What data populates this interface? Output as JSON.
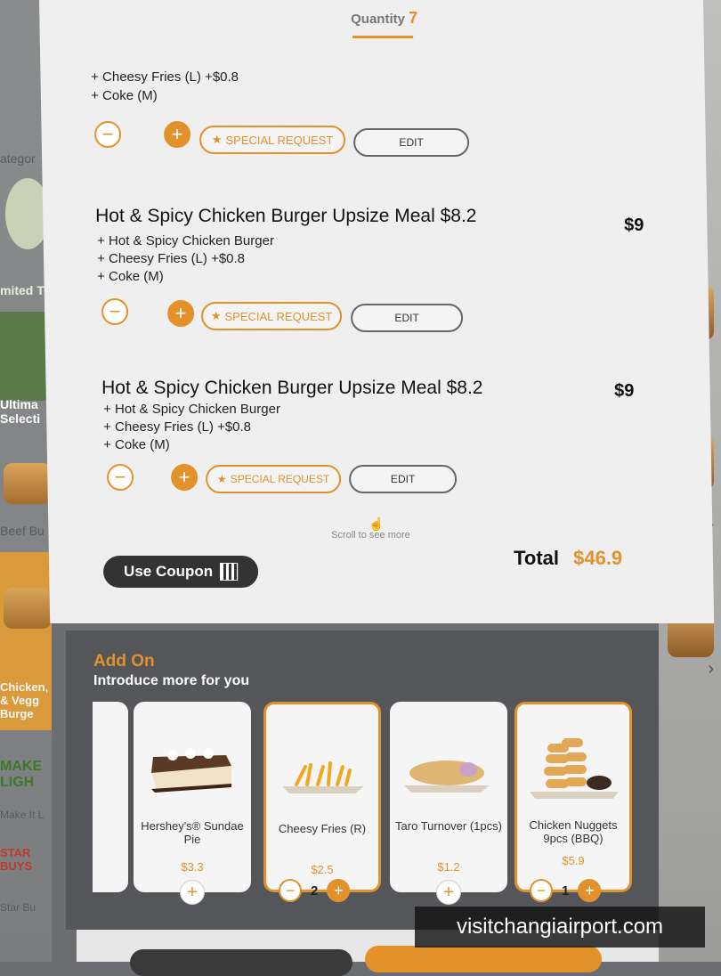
{
  "header": {
    "quantity_label": "Quantity",
    "quantity_value": "7"
  },
  "order_items": [
    {
      "title": "",
      "price": "",
      "lines": [
        "+ Cheesy Fries (L) +$0.8",
        "+ Coke (M)"
      ],
      "special_request": "SPECIAL REQUEST",
      "edit": "EDIT"
    },
    {
      "title": "Hot & Spicy Chicken Burger Upsize Meal $8.2",
      "price": "$9",
      "lines": [
        "+ Hot & Spicy Chicken Burger",
        "+ Cheesy Fries (L) +$0.8",
        "+ Coke (M)"
      ],
      "special_request": "SPECIAL REQUEST",
      "edit": "EDIT"
    },
    {
      "title": "Hot & Spicy Chicken Burger Upsize Meal $8.2",
      "price": "$9",
      "lines": [
        "+ Hot & Spicy Chicken Burger",
        "+ Cheesy Fries (L) +$0.8",
        "+ Coke (M)"
      ],
      "special_request": "SPECIAL REQUEST",
      "edit": "EDIT"
    }
  ],
  "scroll_hint": "Scroll to see more",
  "coupon": {
    "label": "Use Coupon"
  },
  "total": {
    "label": "Total",
    "value": "$46.9"
  },
  "addon": {
    "title": "Add On",
    "subtitle": "Introduce more for you",
    "items": [
      {
        "name": "Hershey's® Sundae Pie",
        "price": "$3.3",
        "quantity": null
      },
      {
        "name": "Cheesy Fries (R)",
        "price": "$2.5",
        "quantity": "2"
      },
      {
        "name": "Taro Turnover (1pcs)",
        "price": "$1.2",
        "quantity": null
      },
      {
        "name": "Chicken Nuggets 9pcs (BBQ)",
        "price": "$5.9",
        "quantity": "1"
      }
    ]
  },
  "background": {
    "left_categories": [
      "ategor",
      "mited T",
      "Ultima Selecti",
      "Beef Bu",
      "Chicken, & Vegg Burge",
      "Make It L",
      "Star Bu"
    ],
    "badge_texts": [
      "MAKE LIGH",
      "STAR BUYS"
    ]
  },
  "watermark": "visitchangiairport.com",
  "colors": {
    "accent": "#e2912b",
    "panel": "#efefef",
    "addon_bg": "#54565a",
    "coupon_bg": "#333333"
  }
}
